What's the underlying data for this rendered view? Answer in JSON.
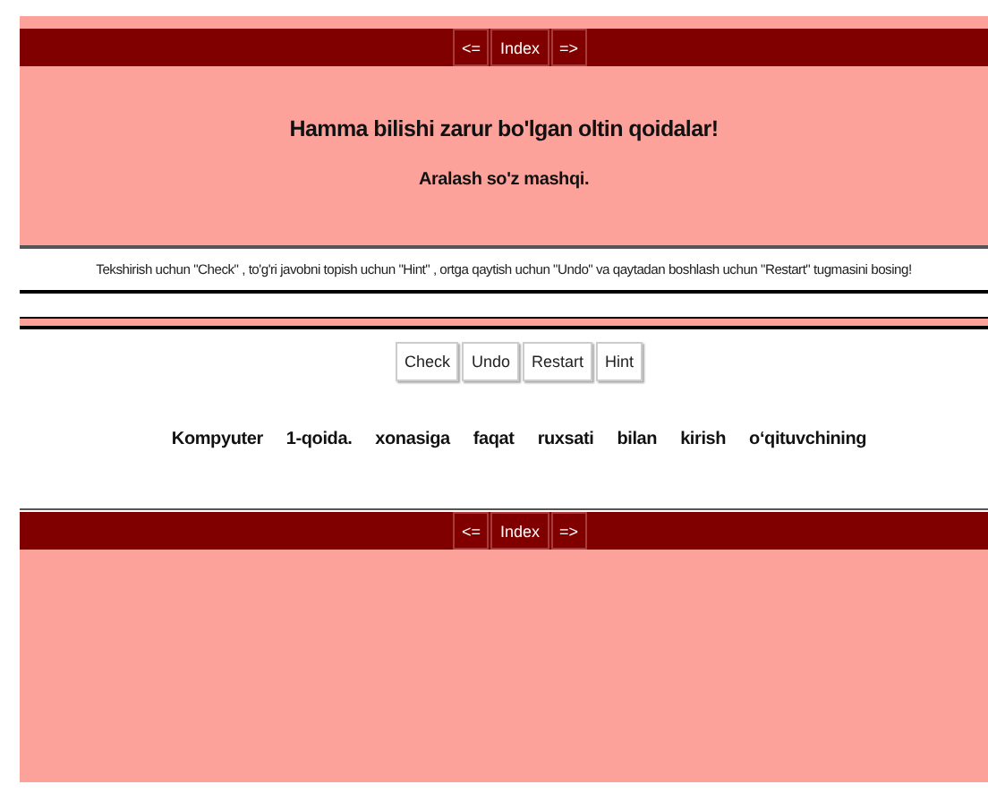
{
  "top_nav": [
    "<=",
    "Index",
    "=>"
  ],
  "header": {
    "title": "Hamma bilishi zarur bo'lgan oltin qoidalar!",
    "subtitle": "Aralash so'z mashqi."
  },
  "instructions": "Tekshirish uchun \"Check\" , to'g'ri javobni topish uchun \"Hint\" , ortga qaytish uchun \"Undo\" va qaytadan boshlash uchun \"Restart\" tugmasini bosing!",
  "buttons": [
    "Check",
    "Undo",
    "Restart",
    "Hint"
  ],
  "words": [
    "Kompyuter",
    "1-qoida.",
    "xonasiga",
    "faqat",
    "ruxsati",
    "bilan",
    "kirish",
    "o‘qituvchining"
  ],
  "bottom_nav": [
    "<=",
    "Index",
    "=>"
  ]
}
